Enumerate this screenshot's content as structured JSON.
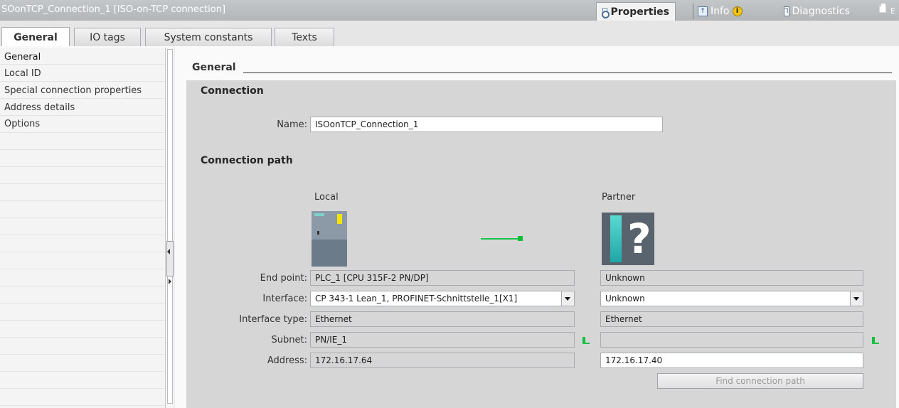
{
  "window": {
    "title": "SOonTCP_Connection_1 [ISO-on-TCP connection]",
    "inspector_tabs": [
      {
        "label": "Properties",
        "icon": "properties-icon"
      },
      {
        "label": "Info",
        "icon": "info-icon",
        "badge_icon": "warning-icon",
        "badge": "i"
      },
      {
        "label": "Diagnostics",
        "icon": "diagnostics-icon"
      }
    ],
    "edge_char": "E"
  },
  "tabs": [
    "General",
    "IO tags",
    "System constants",
    "Texts"
  ],
  "active_tab": "General",
  "nav": {
    "items": [
      "General",
      "Local ID",
      "Special connection properties",
      "Address details",
      "Options"
    ],
    "selected": "General"
  },
  "section": {
    "title": "General"
  },
  "connection": {
    "header": "Connection",
    "name_label": "Name:",
    "name_value": "ISOonTCP_Connection_1"
  },
  "path": {
    "header": "Connection path",
    "local_label": "Local",
    "partner_label": "Partner",
    "end_point_label": "End point:",
    "interface_label": "Interface:",
    "interface_type_label": "Interface type:",
    "subnet_label": "Subnet:",
    "address_label": "Address:",
    "local": {
      "end_point": "PLC_1 [CPU 315F-2 PN/DP]",
      "interface": "CP 343-1 Lean_1, PROFINET-Schnittstelle_1[X1]",
      "interface_type": "Ethernet",
      "subnet": "PN/IE_1",
      "address": "172.16.17.64"
    },
    "partner": {
      "end_point": "Unknown",
      "interface": "Unknown",
      "interface_type": "Ethernet",
      "subnet": "",
      "address": "172.16.17.40"
    },
    "find_button": "Find connection path"
  },
  "colors": {
    "titlebar": "#b3b6b8",
    "panel": "#d6d6d6",
    "link_green": "#18c34a",
    "plc_yellow": "#f3e600",
    "partner_cyan": "#20a6a8"
  }
}
